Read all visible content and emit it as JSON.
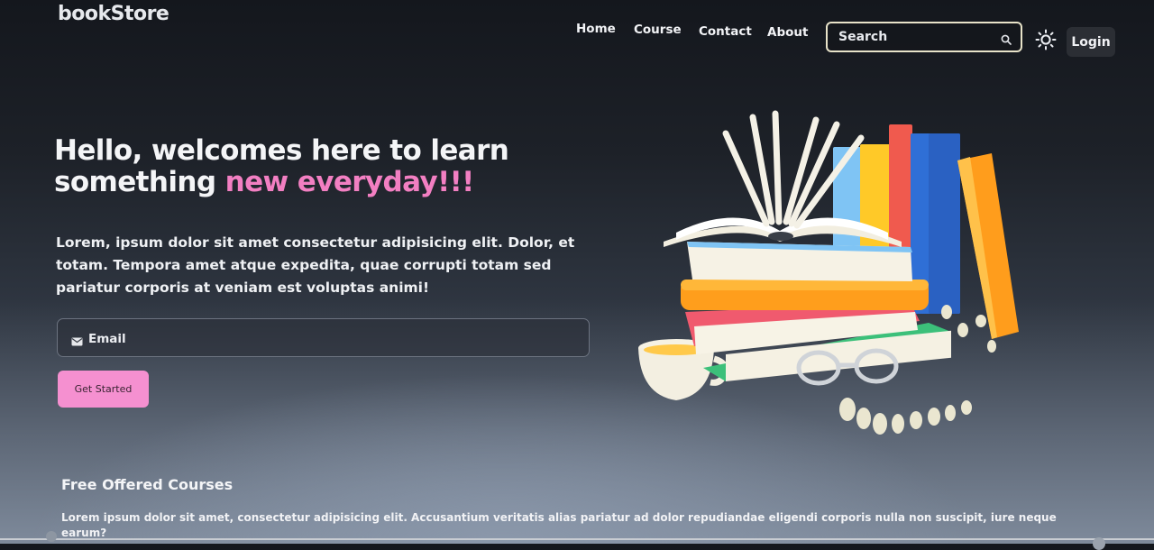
{
  "header": {
    "brand": "bookStore",
    "nav": [
      {
        "label": "Home"
      },
      {
        "label": "Course"
      },
      {
        "label": "Contact"
      },
      {
        "label": "About"
      }
    ],
    "search": {
      "placeholder": "Search",
      "icon": "search-icon"
    },
    "theme_icon": "sun-icon",
    "login_label": "Login"
  },
  "hero": {
    "title_line1": "Hello, welcomes here to learn",
    "title_line2_prefix": "something ",
    "title_accent": "new everyday!!!",
    "description": "Lorem, ipsum dolor sit amet consectetur adipisicing elit. Dolor, et totam. Tempora amet atque expedita, quae corrupti totam sed pariatur corporis at veniam est voluptas animi!",
    "email": {
      "placeholder": "Email",
      "icon": "envelope-icon"
    },
    "cta_label": "Get Started",
    "illustration": "books-stack-illustration"
  },
  "courses": {
    "title": "Free Offered Courses",
    "description": "Lorem ipsum dolor sit amet, consectetur adipisicing elit. Accusantium veritatis alias pariatur ad dolor repudiandae eligendi corporis nulla non suscipit, iure neque earum?"
  },
  "colors": {
    "accent_pink": "#f27fc2",
    "button_pink": "#f590d0",
    "search_border": "#e8e3c9",
    "login_bg": "#2b2e34"
  }
}
